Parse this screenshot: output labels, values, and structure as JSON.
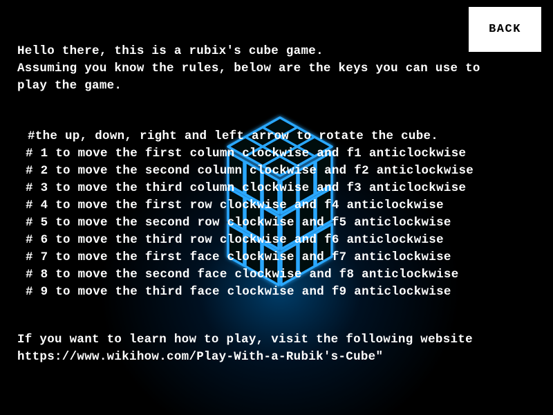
{
  "intro": {
    "line1": "Hello there, this is a rubix's cube game.",
    "line2": "Assuming you know the rules, below are the keys you can use to",
    "line3": "play the game."
  },
  "keys": {
    "arrows": "#the up, down, right and left arrow to rotate the cube.",
    "items": [
      "# 1 to move the first column clockwise and f1 anticlockwise",
      "# 2 to move the second column clockwise and f2 anticlockwise",
      "# 3 to move the third column clockwise and f3 anticlockwise",
      "# 4 to move the first row clockwise and f4 anticlockwise",
      "# 5 to move the second row clockwise and f5 anticlockwise",
      "# 6 to move the third row clockwise and f6 anticlockwise",
      "# 7 to move the first face clockwise and f7 anticlockwise",
      "# 8 to move the second face clockwise and f8 anticlockwise",
      "# 9 to move the third face clockwise and f9 anticlockwise"
    ]
  },
  "footer": {
    "line1": "If you want to learn how to play, visit the following website",
    "line2": "https://www.wikihow.com/Play-With-a-Rubik's-Cube\""
  },
  "back_button": {
    "label": "BACK"
  },
  "colors": {
    "background": "#000000",
    "text": "#ffffff",
    "cube_glow": "#2aa8ff",
    "button_bg": "#ffffff",
    "button_text": "#000000"
  },
  "background_image": {
    "icon": "glowing-rubiks-cube-icon"
  }
}
